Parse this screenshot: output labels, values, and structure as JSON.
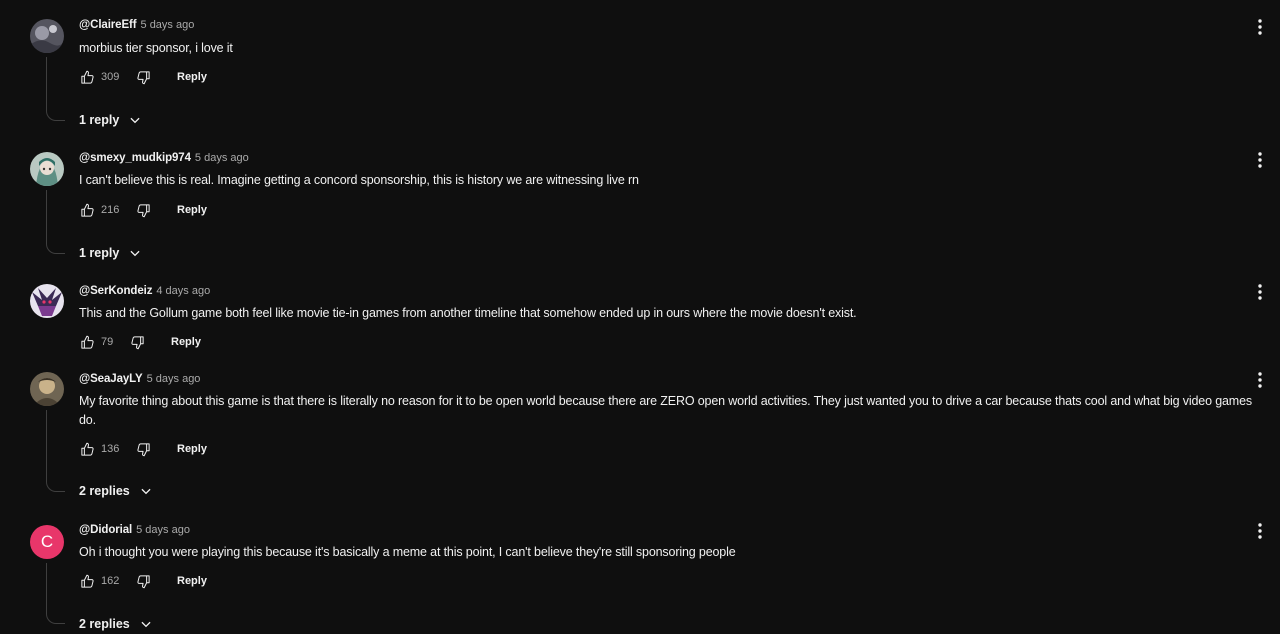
{
  "comments": [
    {
      "author": "@ClaireEff",
      "time": "5 days ago",
      "text": "morbius tier sponsor, i love it",
      "likes": "309",
      "reply_label": "Reply",
      "replies_label": "1 reply",
      "avatar_color": "#6a6a78"
    },
    {
      "author": "@smexy_mudkip974",
      "time": "5 days ago",
      "text": "I can't believe this is real. Imagine getting a concord sponsorship, this is history we are witnessing live rn",
      "likes": "216",
      "reply_label": "Reply",
      "replies_label": "1 reply",
      "avatar_color": "#7fa39a"
    },
    {
      "author": "@SerKondeiz",
      "time": "4 days ago",
      "text": "This and the Gollum game both feel like movie tie-in games from another timeline that somehow ended up in ours where the movie doesn't exist.",
      "likes": "79",
      "reply_label": "Reply",
      "avatar_color": "#5a3f6e"
    },
    {
      "author": "@SeaJayLY",
      "time": "5 days ago",
      "text": "My favorite thing about this game is that there is literally no reason for it to be open world because there are ZERO open world activities. They just wanted you to drive a car because thats cool and what big video games do.",
      "likes": "136",
      "reply_label": "Reply",
      "replies_label": "2 replies",
      "avatar_color": "#8a7a60"
    },
    {
      "author": "@Didorial",
      "time": "5 days ago",
      "text": "Oh i thought you were playing this because it's basically a meme at this point, I can't believe they're still sponsoring people",
      "likes": "162",
      "reply_label": "Reply",
      "replies_label": "2 replies",
      "avatar_letter": "C",
      "avatar_color": "#e8366a"
    }
  ],
  "icons": {
    "like": "thumbs-up-icon",
    "dislike": "thumbs-down-icon",
    "menu": "more-vert-icon",
    "expand": "chevron-down-icon"
  }
}
